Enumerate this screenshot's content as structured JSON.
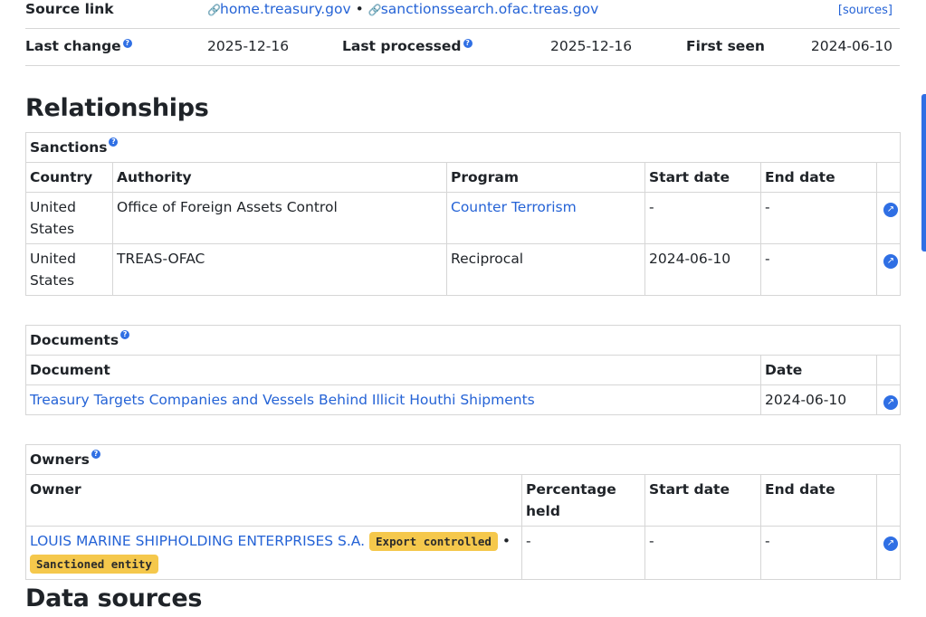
{
  "info": {
    "source_link_label": "Source link",
    "source_links": [
      "home.treasury.gov",
      "sanctionssearch.ofac.treas.gov"
    ],
    "separator": "•",
    "sources_label": "[sources]",
    "last_change_label": "Last change",
    "last_change": "2025-12-16",
    "last_processed_label": "Last processed",
    "last_processed": "2025-12-16",
    "first_seen_label": "First seen",
    "first_seen": "2024-06-10"
  },
  "relationships_heading": "Relationships",
  "sanctions": {
    "title": "Sanctions",
    "headers": [
      "Country",
      "Authority",
      "Program",
      "Start date",
      "End date"
    ],
    "rows": [
      {
        "country": "United States",
        "authority": "Office of Foreign Assets Control",
        "program": "Counter Terrorism",
        "start": "-",
        "end": "-"
      },
      {
        "country": "United States",
        "authority": "TREAS-OFAC",
        "program": "Reciprocal",
        "start": "2024-06-10",
        "end": "-"
      }
    ]
  },
  "documents": {
    "title": "Documents",
    "headers": [
      "Document",
      "Date"
    ],
    "rows": [
      {
        "document": "Treasury Targets Companies and Vessels Behind Illicit Houthi Shipments",
        "date": "2024-06-10"
      }
    ]
  },
  "owners": {
    "title": "Owners",
    "headers": [
      "Owner",
      "Percentage held",
      "Start date",
      "End date"
    ],
    "rows": [
      {
        "owner": "LOUIS MARINE SHIPHOLDING ENTERPRISES S.A.",
        "tags": [
          "Export controlled",
          "Sanctioned entity"
        ],
        "percentage": "-",
        "start": "-",
        "end": "-"
      }
    ]
  },
  "data_sources_heading": "Data sources",
  "icons": {
    "link": "link-icon",
    "help": "help-icon",
    "open": "open-external-icon"
  },
  "colors": {
    "link": "#2563d6",
    "tag": "#f5c84c",
    "icon": "#2f6fe4"
  }
}
